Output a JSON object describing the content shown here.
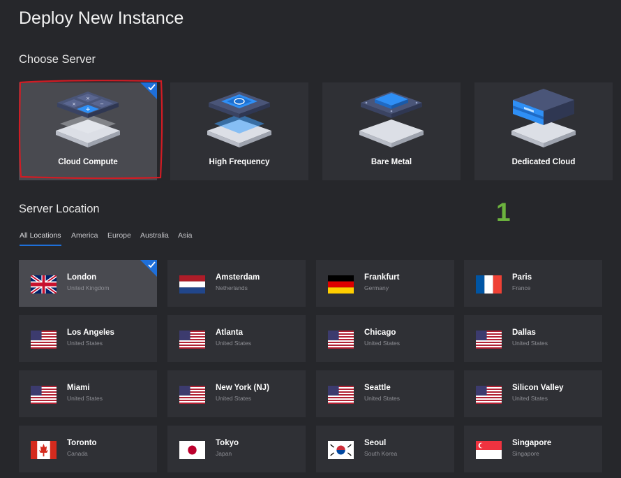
{
  "page_title": "Deploy New Instance",
  "choose_server": {
    "title": "Choose Server",
    "options": [
      {
        "label": "Cloud Compute",
        "selected": true
      },
      {
        "label": "High Frequency",
        "selected": false
      },
      {
        "label": "Bare Metal",
        "selected": false
      },
      {
        "label": "Dedicated Cloud",
        "selected": false
      }
    ]
  },
  "annotation": "1",
  "server_location": {
    "title": "Server Location",
    "tabs": [
      "All Locations",
      "America",
      "Europe",
      "Australia",
      "Asia"
    ],
    "active_tab": "All Locations",
    "locations": [
      {
        "city": "London",
        "country": "United Kingdom",
        "flag": "uk-flag-icon",
        "selected": true
      },
      {
        "city": "Amsterdam",
        "country": "Netherlands",
        "flag": "netherlands-flag-icon"
      },
      {
        "city": "Frankfurt",
        "country": "Germany",
        "flag": "germany-flag-icon"
      },
      {
        "city": "Paris",
        "country": "France",
        "flag": "france-flag-icon"
      },
      {
        "city": "Los Angeles",
        "country": "United States",
        "flag": "us-flag-icon"
      },
      {
        "city": "Atlanta",
        "country": "United States",
        "flag": "us-flag-icon"
      },
      {
        "city": "Chicago",
        "country": "United States",
        "flag": "us-flag-icon"
      },
      {
        "city": "Dallas",
        "country": "United States",
        "flag": "us-flag-icon"
      },
      {
        "city": "Miami",
        "country": "United States",
        "flag": "us-flag-icon"
      },
      {
        "city": "New York (NJ)",
        "country": "United States",
        "flag": "us-flag-icon"
      },
      {
        "city": "Seattle",
        "country": "United States",
        "flag": "us-flag-icon"
      },
      {
        "city": "Silicon Valley",
        "country": "United States",
        "flag": "us-flag-icon"
      },
      {
        "city": "Toronto",
        "country": "Canada",
        "flag": "canada-flag-icon"
      },
      {
        "city": "Tokyo",
        "country": "Japan",
        "flag": "japan-flag-icon"
      },
      {
        "city": "Seoul",
        "country": "South Korea",
        "flag": "south-korea-flag-icon"
      },
      {
        "city": "Singapore",
        "country": "Singapore",
        "flag": "singapore-flag-icon"
      }
    ]
  },
  "colors": {
    "background": "#26272b",
    "card": "#2f3035",
    "card_selected": "#494a50",
    "accent": "#1e6fd9",
    "highlight_outline": "#d01c24",
    "annotation": "#6cb33e"
  }
}
